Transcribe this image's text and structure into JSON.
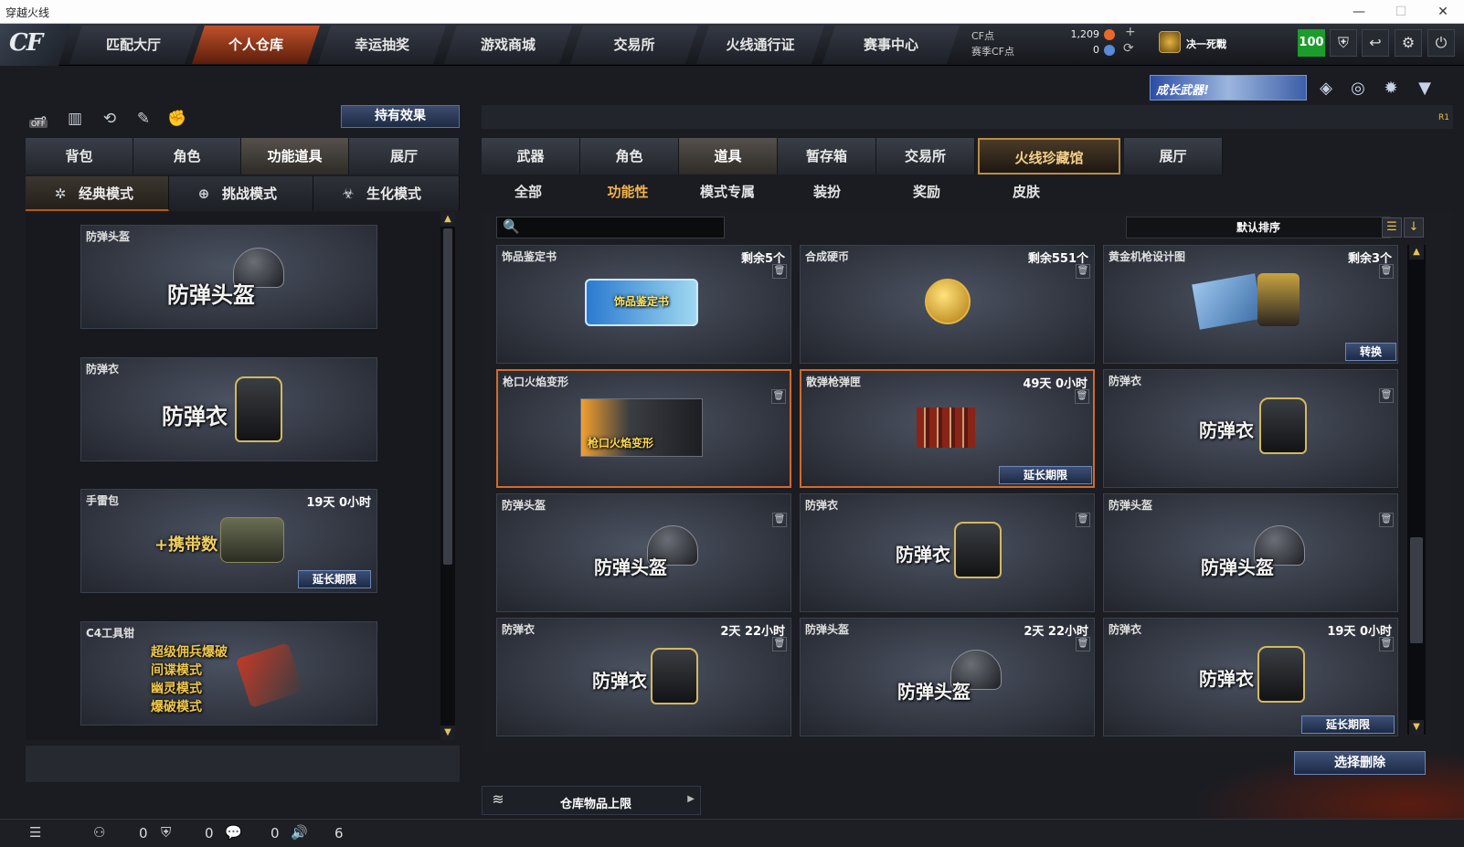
{
  "window": {
    "title": "穿越火线"
  },
  "nav": {
    "tabs": [
      "匹配大厅",
      "个人仓库",
      "幸运抽奖",
      "游戏商城",
      "交易所",
      "火线通行证",
      "赛事中心"
    ]
  },
  "points": {
    "cf_label": "CF点",
    "cf_value": "1,209",
    "season_label": "赛季CF点",
    "season_value": "0",
    "add_icon": "+",
    "refresh_icon": "⟳"
  },
  "rank": {
    "name": "决一死戰"
  },
  "level": "100",
  "banner": {
    "text": "成长武器!"
  },
  "left": {
    "effect_button": "持有效果",
    "off_label": "OFF",
    "tabs": [
      "背包",
      "角色",
      "功能道具",
      "展厅"
    ],
    "modes": [
      "经典模式",
      "挑战模式",
      "生化模式"
    ],
    "items": [
      {
        "name": "防弹头盔",
        "big": "防弹头盔",
        "time": ""
      },
      {
        "name": "防弹衣",
        "big": "防弹衣",
        "time": ""
      },
      {
        "name": "手雷包",
        "big": "+携带数",
        "time": "19天 0小时",
        "button": "延长期限"
      },
      {
        "name": "C4工具钳",
        "lines": [
          "超级佣兵爆破",
          "间谍模式",
          "幽灵模式",
          "爆破模式"
        ],
        "time": ""
      }
    ]
  },
  "right": {
    "tabs": [
      "武器",
      "角色",
      "道具",
      "暂存箱",
      "交易所",
      "火线珍藏馆",
      "展厅"
    ],
    "subtabs": [
      "全部",
      "功能性",
      "模式专属",
      "装扮",
      "奖励",
      "皮肤"
    ],
    "search_placeholder": "",
    "sort_label": "默认排序",
    "cards": [
      {
        "name": "饰品鉴定书",
        "info": "剩余5个",
        "art": "饰品鉴定书"
      },
      {
        "name": "合成硬币",
        "info": "剩余551个",
        "art": ""
      },
      {
        "name": "黄金机枪设计图",
        "info": "剩余3个",
        "art": "",
        "button": "转换"
      },
      {
        "name": "枪口火焰变形",
        "info": "",
        "art": "枪口火焰变形"
      },
      {
        "name": "散弹枪弹匣",
        "info": "49天 0小时",
        "art": "",
        "button": "延长期限"
      },
      {
        "name": "防弹衣",
        "info": "",
        "art": "防弹衣"
      },
      {
        "name": "防弹头盔",
        "info": "",
        "art": "防弹头盔"
      },
      {
        "name": "防弹衣",
        "info": "",
        "art": "防弹衣"
      },
      {
        "name": "防弹头盔",
        "info": "",
        "art": "防弹头盔"
      },
      {
        "name": "防弹衣",
        "info": "2天 22小时",
        "art": "防弹衣"
      },
      {
        "name": "防弹头盔",
        "info": "2天 22小时",
        "art": "防弹头盔"
      },
      {
        "name": "防弹衣",
        "info": "19天 0小时",
        "art": "防弹衣",
        "button": "延长期限"
      }
    ],
    "delete_button": "选择删除",
    "capacity_label": "仓库物品上限",
    "r1": "R1"
  },
  "status": {
    "friends": "0",
    "shield": "0",
    "chat": "0",
    "volume": "6"
  },
  "colors": {
    "accent": "#c0502a",
    "gold": "#f2b34a",
    "level_green": "#1c9c2c"
  }
}
